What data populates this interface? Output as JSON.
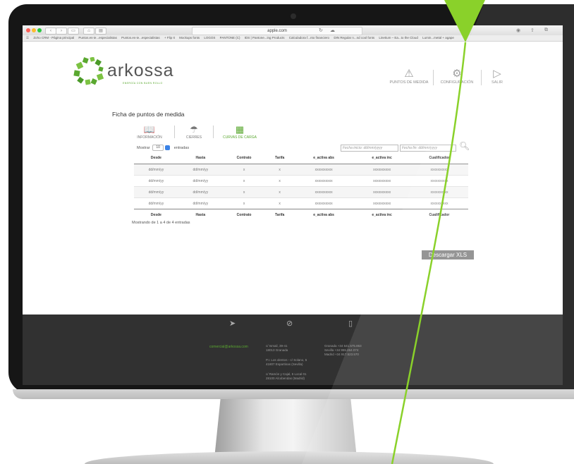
{
  "browser": {
    "url": "apple.com",
    "bookmarks": [
      "Zoho CRM - Página principal",
      "Puntos.es-ie...especialistas",
      "Puntos.es-ie...especialistas",
      "+ Flip It",
      "Mockups fonts",
      "LOGOS",
      "PANTONE (C)",
      "IDS | Pantone...ing Products",
      "Calculadora f...nto financiero",
      "DIN Regular n...nd cool fonts",
      "Linetium – Ea...to the Cloud",
      "Lumin...metal + agape"
    ]
  },
  "header": {
    "logo_text": "arkossa",
    "logo_tagline": "ENERGÍA CON BUEN ROLLO",
    "nav": {
      "puntos": "PUNTOS DE MEDIDA",
      "config": "CONFIGURACIÓN",
      "salir": "SALIR"
    }
  },
  "page": {
    "title": "Ficha de puntos de medida",
    "tabs": {
      "info": "INFORMACIÓN",
      "cierres": "CIERRES",
      "curvas": "CURVAS DE CARGA"
    }
  },
  "table_controls": {
    "show_label": "Mostrar",
    "page_size": "10",
    "entries_label": "entradas",
    "start_placeholder": "Fecha inicio: dd/mm/yyyy",
    "end_placeholder": "Fecha fin: dd/mm/yyyy"
  },
  "table": {
    "columns": [
      "Desde",
      "Hasta",
      "Contrato",
      "Tarifa",
      "e_activa abs",
      "e_activa inc",
      "Cualificador"
    ],
    "rows": [
      [
        "dd/mm/yy",
        "dd/mm/yy",
        "x",
        "x",
        "xxxxxxxxxx",
        "xxxxxxxxxx",
        "xxxxxxxxxx"
      ],
      [
        "dd/mm/yy",
        "dd/mm/yy",
        "x",
        "x",
        "xxxxxxxxxx",
        "xxxxxxxxxx",
        "xxxxxxxxxx"
      ],
      [
        "dd/mm/yy",
        "dd/mm/yy",
        "x",
        "x",
        "xxxxxxxxxx",
        "xxxxxxxxxx",
        "xxxxxxxxxx"
      ],
      [
        "dd/mm/yy",
        "dd/mm/yy",
        "x",
        "x",
        "xxxxxxxxxx",
        "xxxxxxxxxx",
        "xxxxxxxxxx"
      ]
    ],
    "info": "Mostrando de 1 a 4 de 4 entradas"
  },
  "download_label": "Descargar XLS",
  "footer": {
    "email": "comercial@arkossa.com",
    "addr1": "c/ Ismail, 39-41",
    "addr2": "18013 Granada",
    "addr3": "P.I. Los olentos - c/ Solano, 5",
    "addr4": "41807 Espartinas (Sevilla)",
    "addr5": "c/ Ramón y Cajal, 5 Local 01",
    "addr6": "28100 Alcobendas (Madrid)",
    "phone1": "Granada +34 641.575.863",
    "phone2": "Sevilla +34 955.264.074",
    "phone3": "Madrid +34 917.523.570"
  },
  "colors": {
    "brand_green": "#5aa830",
    "stroke_green": "#8ad12a",
    "footer_bg": "#313131",
    "button_grey": "#8a8a8a"
  },
  "icons": {
    "puntos": "warning-triangle-icon",
    "config": "gears-icon",
    "salir": "play-arrow-icon",
    "info": "open-book-icon",
    "cierres": "umbrella-icon",
    "curvas": "chart-board-icon",
    "search": "magnifier-icon",
    "footer_mail": "paper-plane-icon",
    "footer_location": "compass-icon",
    "footer_phone": "phone-icon"
  }
}
